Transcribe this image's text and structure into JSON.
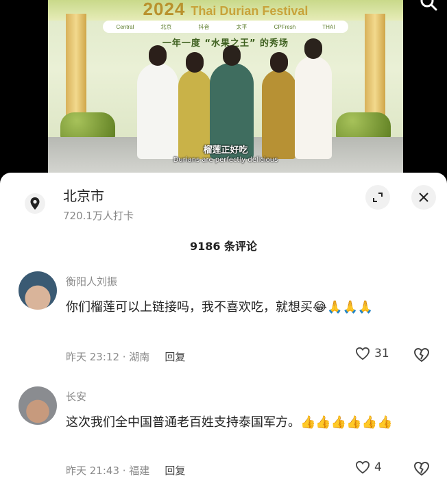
{
  "video": {
    "banner_year": "2024",
    "banner_title": "Thai Durian Festival",
    "logos": [
      "Central",
      "北京",
      "抖音",
      "太平",
      "CPFresh",
      "THAI"
    ],
    "slogan": "一年一度 “水果之王” 的秀场",
    "subtitle_cn": "榴莲正好吃",
    "subtitle_en": "Durians are perfectly delicious",
    "search_icon": "search-icon"
  },
  "location": {
    "name": "北京市",
    "checkins": "720.1万人打卡",
    "pin_icon": "location-pin-icon",
    "expand_icon": "expand-icon",
    "close_icon": "close-icon"
  },
  "comments_header": {
    "count_text": "9186 条评论"
  },
  "comments": [
    {
      "username": "衡阳人刘振",
      "text": "你们榴莲可以上链接吗，我不喜欢吃，就想买😂🙏🙏🙏",
      "time_location": "昨天 23:12 · 湖南",
      "reply": "回复",
      "likes": "31"
    },
    {
      "username": "长安",
      "text": "这次我们全中国普通老百姓支持泰国军方。👍👍👍👍👍👍",
      "time_location": "昨天 21:43 · 福建",
      "reply": "回复",
      "likes": "4"
    }
  ],
  "colors": {
    "sheet_bg": "#ffffff",
    "muted_text": "#8a8a8a",
    "primary_text": "#222222",
    "button_bg": "#f1f1f1"
  }
}
